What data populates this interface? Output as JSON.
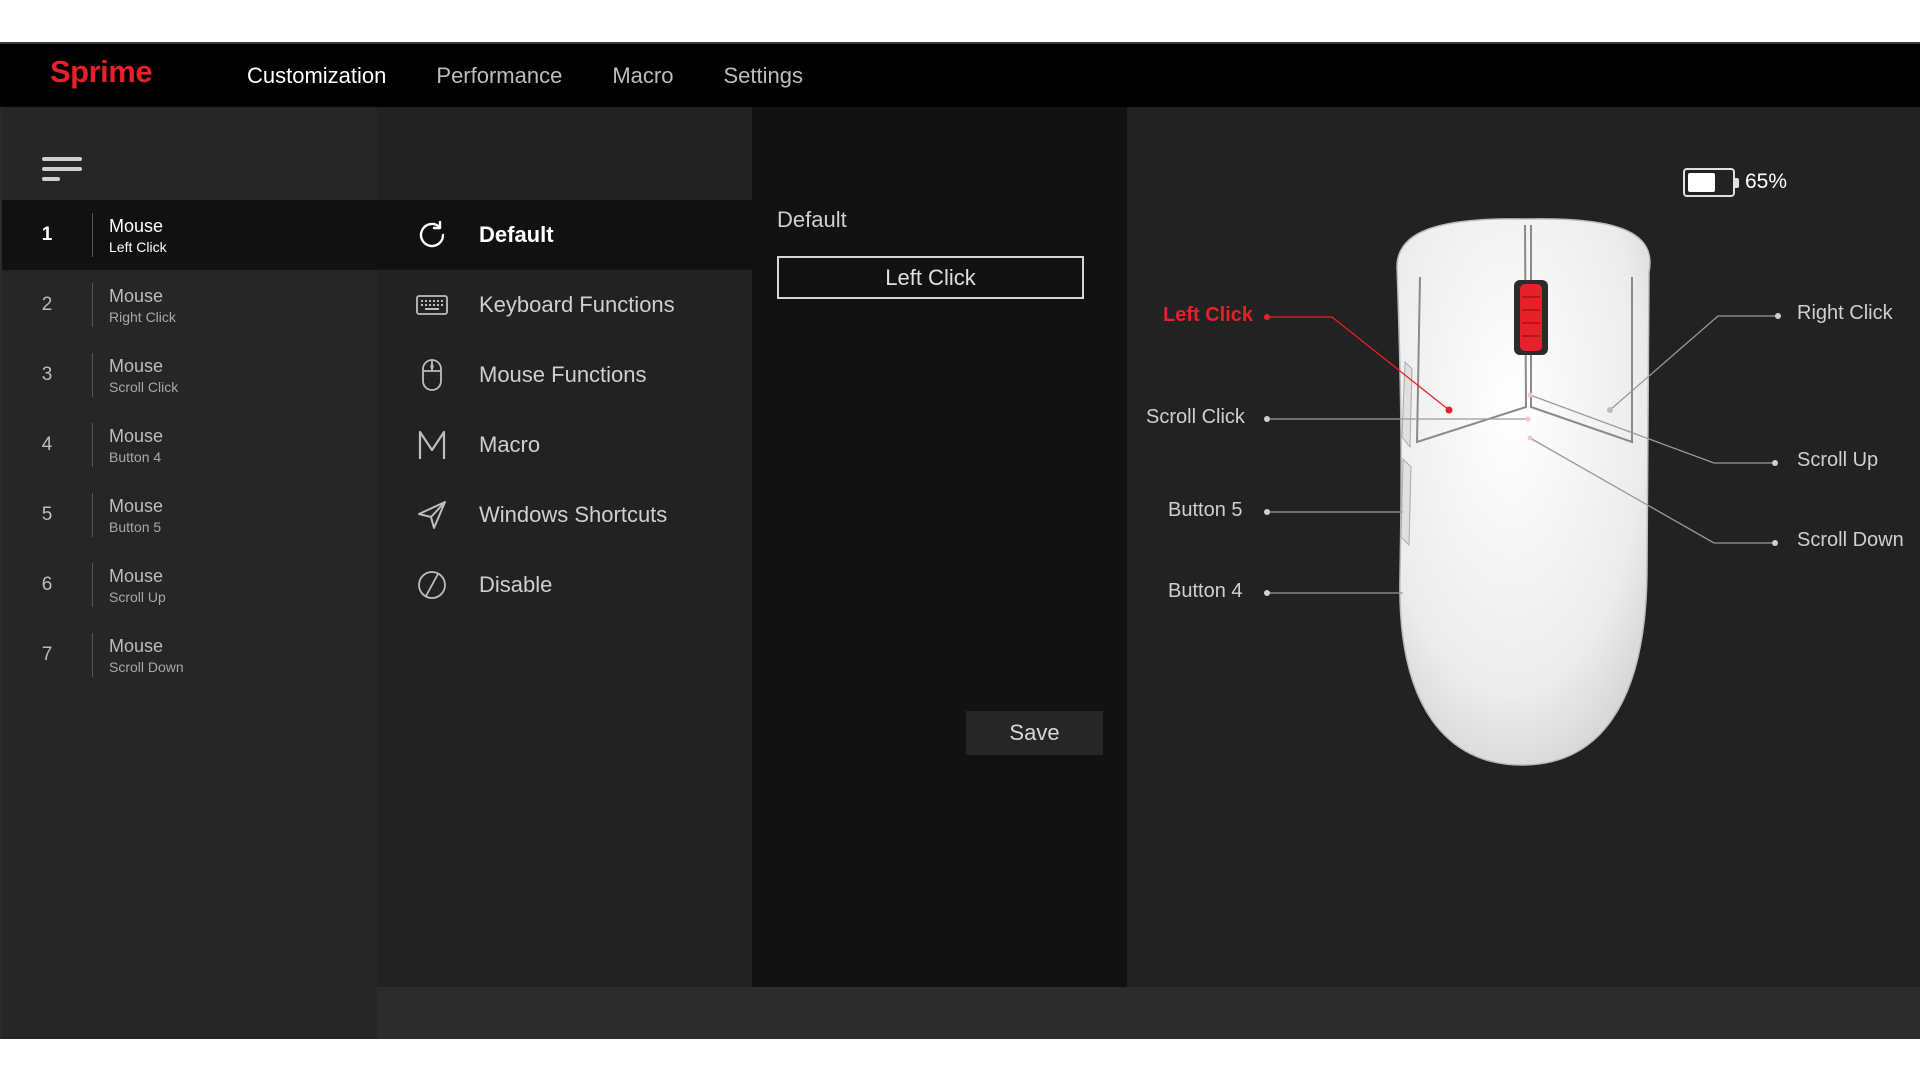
{
  "app": {
    "brand": "Sprime",
    "nav": [
      {
        "label": "Customization",
        "active": true
      },
      {
        "label": "Performance",
        "active": false
      },
      {
        "label": "Macro",
        "active": false
      },
      {
        "label": "Settings",
        "active": false
      }
    ]
  },
  "sidebar": {
    "menu_icon": "hamburger-icon",
    "buttons": [
      {
        "num": "1",
        "title": "Mouse",
        "sub": "Left Click",
        "active": true
      },
      {
        "num": "2",
        "title": "Mouse",
        "sub": "Right Click",
        "active": false
      },
      {
        "num": "3",
        "title": "Mouse",
        "sub": "Scroll Click",
        "active": false
      },
      {
        "num": "4",
        "title": "Mouse",
        "sub": "Button 4",
        "active": false
      },
      {
        "num": "5",
        "title": "Mouse",
        "sub": "Button 5",
        "active": false
      },
      {
        "num": "6",
        "title": "Mouse",
        "sub": "Scroll Up",
        "active": false
      },
      {
        "num": "7",
        "title": "Mouse",
        "sub": "Scroll Down",
        "active": false
      }
    ]
  },
  "functions": [
    {
      "label": "Default",
      "icon": "refresh-icon",
      "active": true
    },
    {
      "label": "Keyboard Functions",
      "icon": "keyboard-icon",
      "active": false
    },
    {
      "label": "Mouse Functions",
      "icon": "mouse-icon",
      "active": false
    },
    {
      "label": "Macro",
      "icon": "macro-m-icon",
      "active": false
    },
    {
      "label": "Windows Shortcuts",
      "icon": "send-arrow-icon",
      "active": false
    },
    {
      "label": "Disable",
      "icon": "disable-slash-icon",
      "active": false
    }
  ],
  "detail": {
    "title": "Default",
    "option": "Left Click",
    "save_label": "Save"
  },
  "preview": {
    "battery_percent": 65,
    "battery_label": "65%",
    "callouts": {
      "left_click": "Left Click",
      "right_click": "Right Click",
      "scroll_click": "Scroll Click",
      "scroll_up": "Scroll Up",
      "button5": "Button 5",
      "scroll_down": "Scroll Down",
      "button4": "Button 4"
    },
    "active_callout": "left_click"
  },
  "colors": {
    "accent": "#e8202a",
    "background": "#2a2a2a",
    "topbar": "#000000"
  }
}
